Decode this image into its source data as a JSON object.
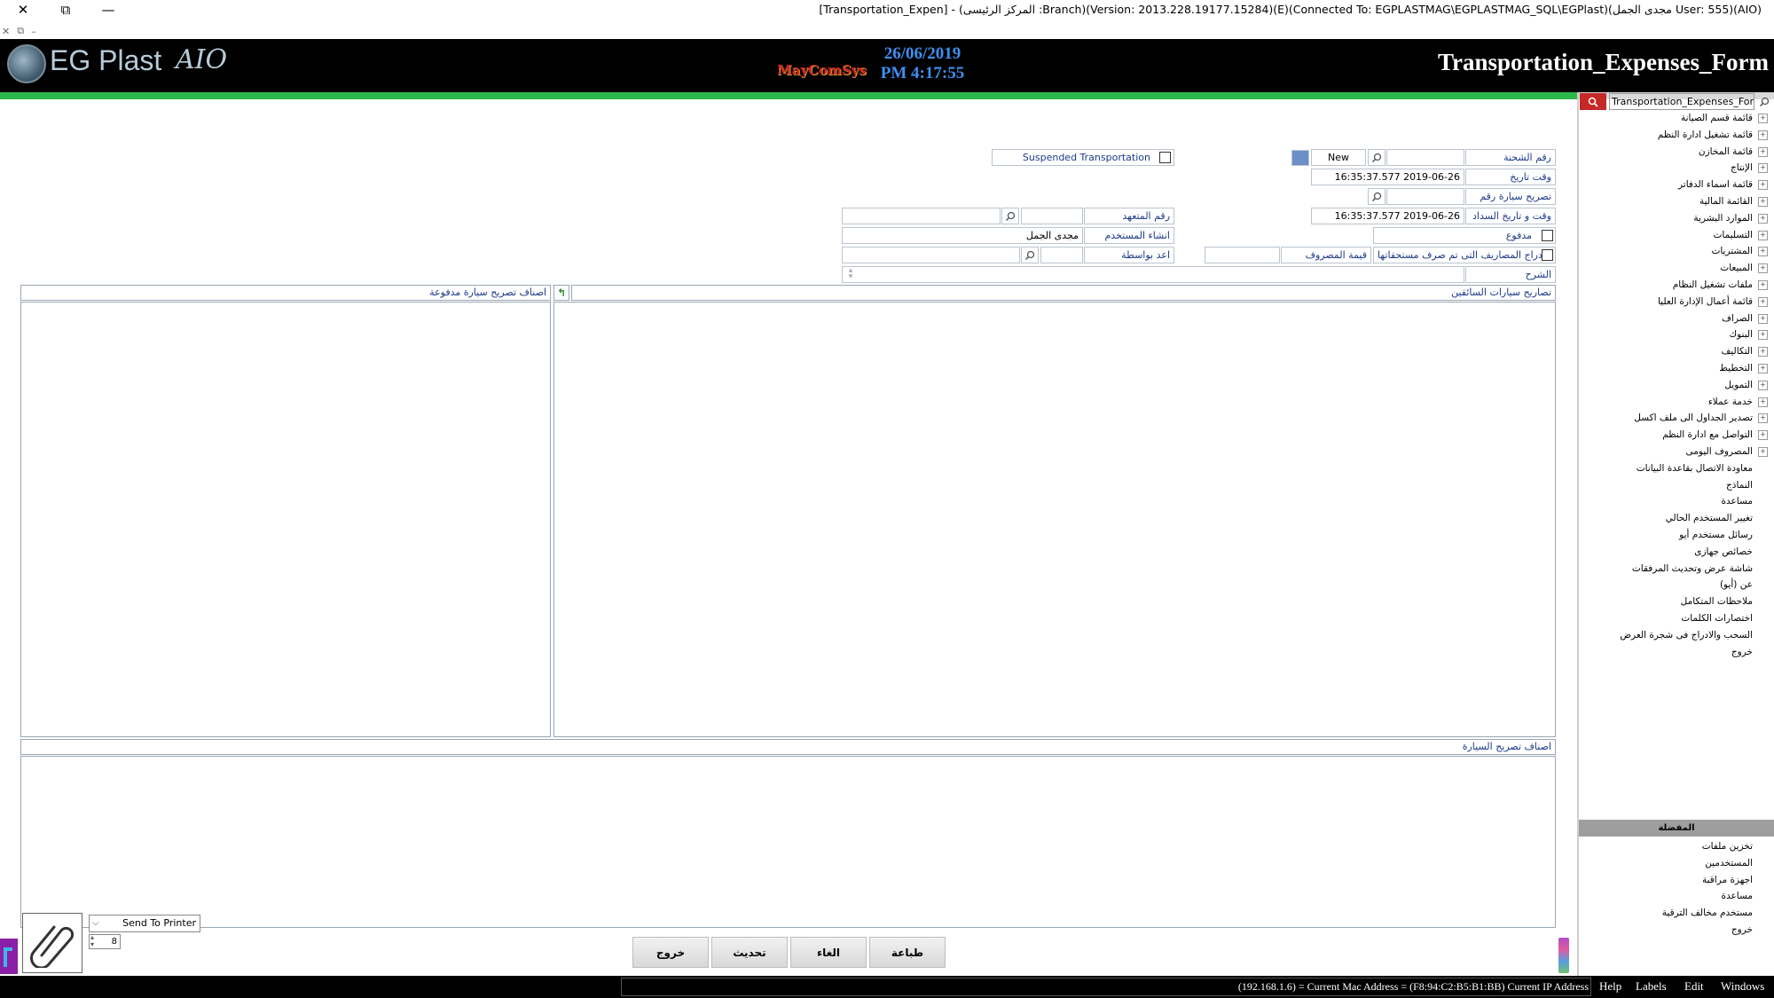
{
  "window": {
    "title": "[Transportation_Expen] - (المركز الرئيسى :Branch)(Version: 2013.228.19177.15284)(E)(Connected To: EGPLASTMAG\\EGPLASTMAG_SQL\\EGPlast)(مجدى الجمل User: 555)(AIO)",
    "close_glyph": "✕",
    "restore_glyph": "⧉",
    "minimize_glyph": "—"
  },
  "header": {
    "logo_text": "EG Plast",
    "logo_aio": "AIO",
    "brand": "MayComSys",
    "date": "26/06/2019",
    "time": "PM 4:17:55",
    "form_title": "Transportation_Expenses_Form"
  },
  "form": {
    "shipment_no_label": "رقم الشحنة",
    "shipment_no_value": "",
    "new_label": "New",
    "suspended_label": "Suspended Transportation",
    "datetime_label": "وقت تاريخ",
    "datetime_value": "16:35:37.577 2019-06-26",
    "car_permit_label": "تصريح سيارة رقم",
    "car_permit_value": "",
    "payment_datetime_label": "وقت و تاريخ السداد",
    "payment_datetime_value": "16:35:37.577 2019-06-26",
    "contractor_no_label": "رقم المتعهد",
    "contractor_no_value": "",
    "contractor_name_value": "",
    "paid_label": "مدفوع",
    "created_user_label": "انشاء المستخدم",
    "created_user_value": "مجدى الجمل",
    "include_expenses_label": "ادراج المصاريف التى تم صرف مستحقاتها",
    "expense_value_label": "قيمة المصروف",
    "expense_value": "",
    "prepared_by_label": "اعد بواسطة",
    "prepared_by_value": "",
    "prepared_by_name": "",
    "explanation_label": "الشرح",
    "explanation_value": ""
  },
  "panels": {
    "drivers_permits": "تصاريح سيارات السائقين",
    "paid_permit_items": "اصناف تصريح سيارة مدفوعة",
    "car_permit_items": "اصناف تصريح السيارة"
  },
  "print": {
    "send_to_printer": "Send To Printer",
    "copies": "8"
  },
  "buttons": {
    "exit": "خروج",
    "update": "تحديث",
    "cancel": "الغاء",
    "print": "طباعة"
  },
  "menu": {
    "search_value": "Transportation_Expenses_Form",
    "items": [
      {
        "label": "قائمة قسم الصيانة",
        "expand": "+"
      },
      {
        "label": "قائمة تشغيل ادارة النظم",
        "expand": "+"
      },
      {
        "label": "قائمة المخازن",
        "expand": "+"
      },
      {
        "label": "الإنتاج",
        "expand": "+"
      },
      {
        "label": "قائمة اسماء الدفاتر",
        "expand": "+"
      },
      {
        "label": "القائمة المالية",
        "expand": "+"
      },
      {
        "label": "الموارد البشرية",
        "expand": "+"
      },
      {
        "label": "التسليمات",
        "expand": "+"
      },
      {
        "label": "المشتريات",
        "expand": "+"
      },
      {
        "label": "المبيعات",
        "expand": "+"
      },
      {
        "label": "ملفات تشغيل النظام",
        "expand": "+"
      },
      {
        "label": "قائمة أعمال الإدارة العليا",
        "expand": "+"
      },
      {
        "label": "الصراف",
        "expand": "+"
      },
      {
        "label": "البنوك",
        "expand": "+"
      },
      {
        "label": "التكاليف",
        "expand": "+"
      },
      {
        "label": "التخطيط",
        "expand": "+"
      },
      {
        "label": "التمويل",
        "expand": "+"
      },
      {
        "label": "خدمة عملاء",
        "expand": "+"
      },
      {
        "label": "تصدير الجداول الى ملف اكسل",
        "expand": "+"
      },
      {
        "label": "التواصل مع ادارة النظم",
        "expand": "+"
      },
      {
        "label": "المصروف اليومى",
        "expand": "+"
      },
      {
        "label": "معاودة الاتصال بقاعدة البيانات",
        "expand": ""
      },
      {
        "label": "النماذج",
        "expand": ""
      },
      {
        "label": "مساعدة",
        "expand": ""
      },
      {
        "label": "تغيير المستخدم الحالي",
        "expand": ""
      },
      {
        "label": "رسائل مستخدم أيو",
        "expand": ""
      },
      {
        "label": "خصائص جهازى",
        "expand": ""
      },
      {
        "label": "شاشة عرض وتحديث المرفقات",
        "expand": ""
      },
      {
        "label": "عن (أيو)",
        "expand": ""
      },
      {
        "label": "ملاحظات المتكامل",
        "expand": ""
      },
      {
        "label": "اختصارات الكلمات",
        "expand": ""
      },
      {
        "label": "السحب والادراج فى شجرة العرض",
        "expand": ""
      },
      {
        "label": "خروج",
        "expand": ""
      }
    ],
    "favorites_header": "المفضلة",
    "favorites": [
      {
        "label": "تخزين ملفات"
      },
      {
        "label": "المستخدمين"
      },
      {
        "label": "اجهزة مراقبة"
      },
      {
        "label": "مساعدة"
      },
      {
        "label": "مستخدم مخالف الترقية"
      },
      {
        "label": "خروج"
      }
    ]
  },
  "status": {
    "address_text": "(192.168.1.6) = Current Mac Address = (F8:94:C2:B5:B1:BB) Current IP Address",
    "menu_help": "Help",
    "menu_labels": "Labels",
    "menu_edit": "Edit",
    "menu_windows": "Windows"
  },
  "colors": {
    "banner": "#000000",
    "green_bar": "#2db94a",
    "date_blue": "#3f8ff0",
    "label_blue": "#1c3a8a",
    "search_red": "#c62828"
  }
}
